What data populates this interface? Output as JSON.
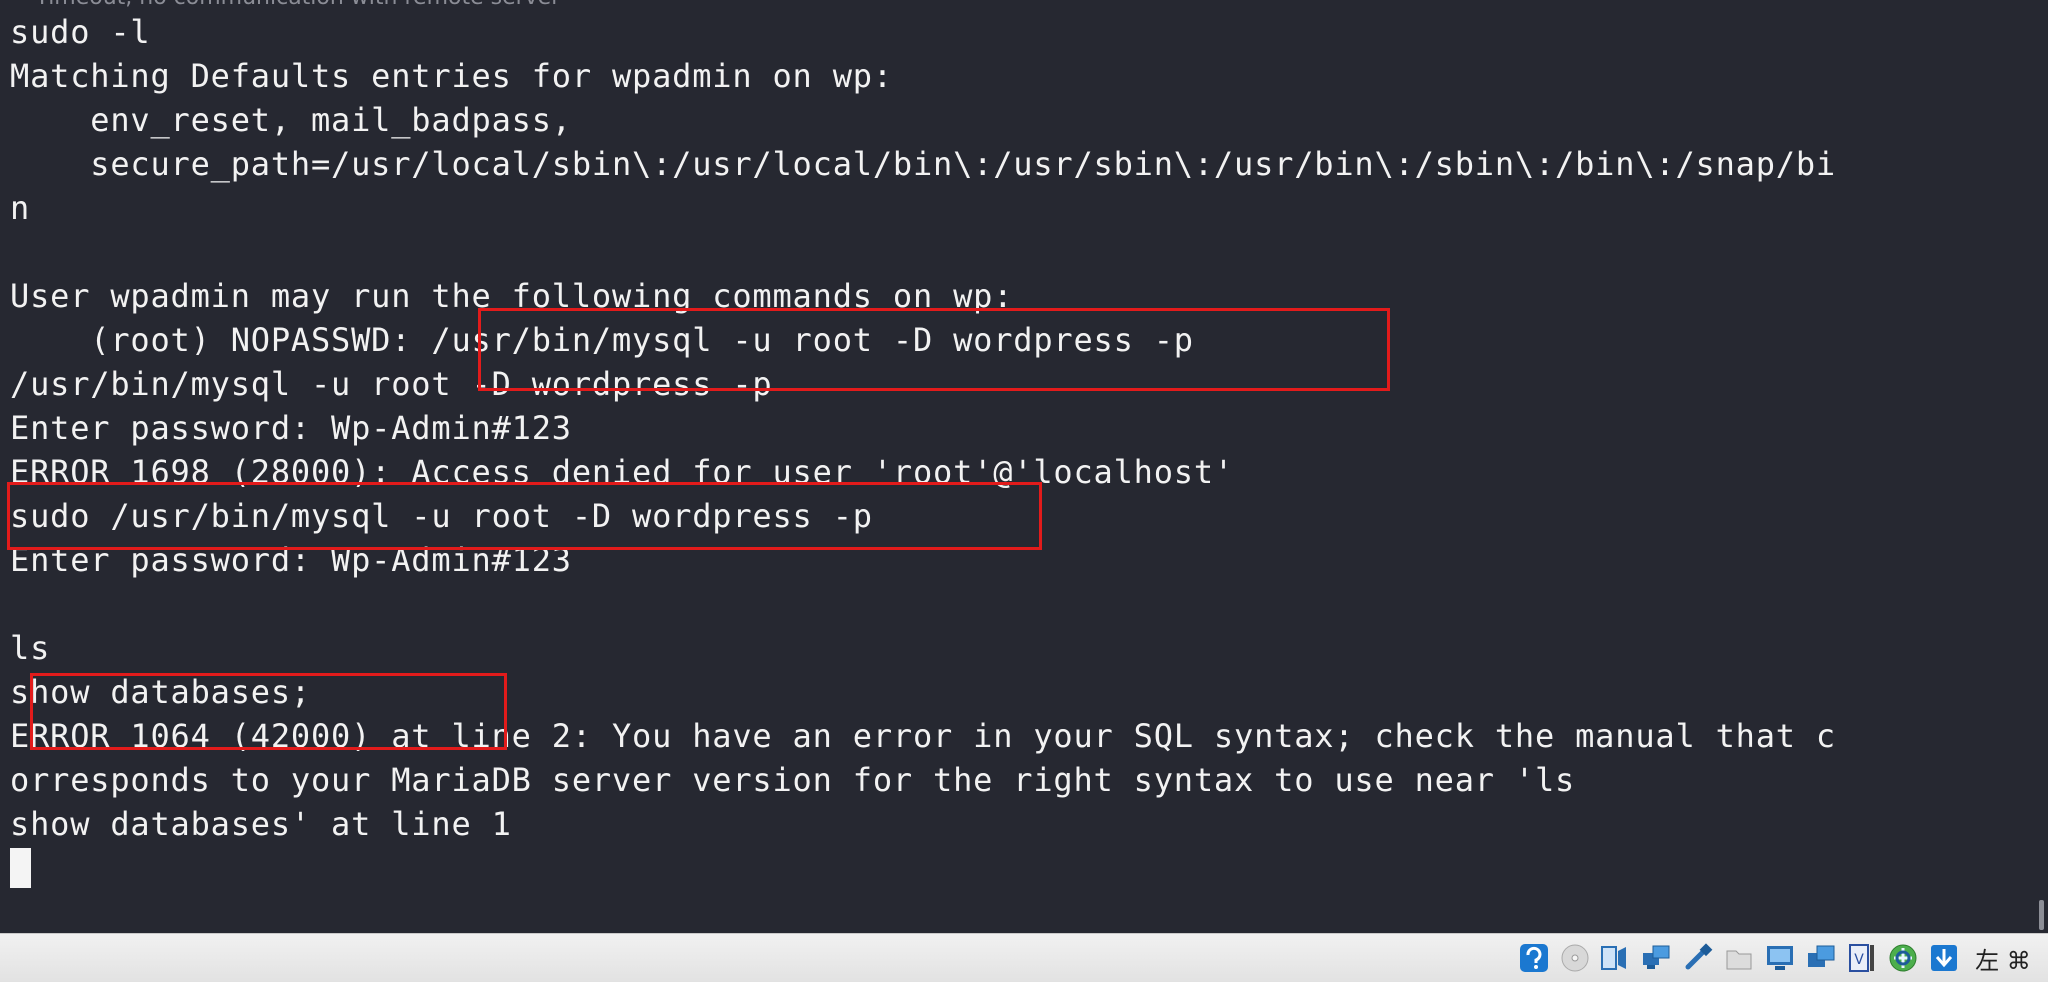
{
  "terminal": {
    "lines": [
      "~ Timeout, no communication with remote server",
      "sudo -l",
      "Matching Defaults entries for wpadmin on wp:",
      "    env_reset, mail_badpass,",
      "    secure_path=/usr/local/sbin\\:/usr/local/bin\\:/usr/sbin\\:/usr/bin\\:/sbin\\:/bin\\:/snap/bi",
      "n",
      "",
      "User wpadmin may run the following commands on wp:",
      "    (root) NOPASSWD: /usr/bin/mysql -u root -D wordpress -p",
      "/usr/bin/mysql -u root -D wordpress -p",
      "Enter password: Wp-Admin#123",
      "ERROR 1698 (28000): Access denied for user 'root'@'localhost'",
      "sudo /usr/bin/mysql -u root -D wordpress -p",
      "Enter password: Wp-Admin#123",
      "",
      "ls",
      "show databases;",
      "ERROR 1064 (42000) at line 2: You have an error in your SQL syntax; check the manual that c",
      "orresponds to your MariaDB server version for the right syntax to use near 'ls",
      "show databases' at line 1"
    ]
  },
  "colors": {
    "terminal_bg": "#262831",
    "text": "#f2f2f2",
    "highlight_box": "#e21b1b",
    "statusbar_bg": "#ececec"
  },
  "statusbar": {
    "icons": [
      "help-icon",
      "optical-disc-icon",
      "audio-icon",
      "network-icon",
      "usb-icon",
      "shared-folder-icon",
      "display-icon",
      "snapshot-icon",
      "video-capture-icon",
      "cpu-activity-icon",
      "arrow-down-icon"
    ],
    "host_key_label": "左 ⌘"
  }
}
